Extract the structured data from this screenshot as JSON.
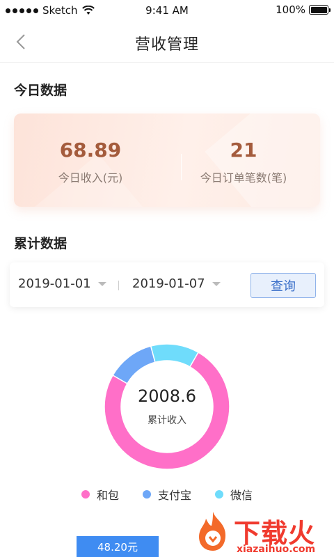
{
  "status_bar": {
    "carrier": "Sketch",
    "time": "9:41 AM",
    "battery": "100%"
  },
  "nav": {
    "title": "营收管理"
  },
  "today": {
    "section_title": "今日数据",
    "income_value": "68.89",
    "income_label": "今日收入(元)",
    "orders_value": "21",
    "orders_label": "今日订单笔数(笔)"
  },
  "cumulative": {
    "section_title": "累计数据",
    "start_date": "2019-01-01",
    "end_date": "2019-01-07",
    "query_label": "查询"
  },
  "chart_data": {
    "type": "pie",
    "center_value": "2008.6",
    "center_label": "累计收入",
    "series": [
      {
        "name": "和包",
        "fraction": 0.75,
        "color": "#ff6fc8"
      },
      {
        "name": "支付宝",
        "fraction": 0.125,
        "color": "#6ea7f7"
      },
      {
        "name": "微信",
        "fraction": 0.125,
        "color": "#6fdcfb"
      }
    ]
  },
  "tooltip": {
    "value": "48.20元"
  },
  "watermark": {
    "text": "下载火",
    "url": "xiazaihuo.com"
  }
}
